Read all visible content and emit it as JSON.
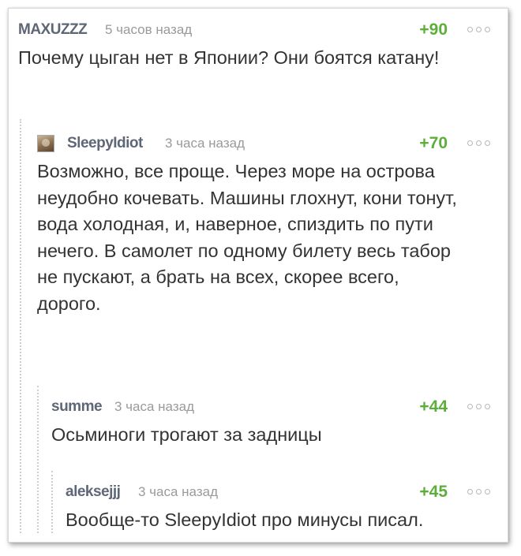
{
  "comments": [
    {
      "author": "MAXUZZZ",
      "time": "5 часов назад",
      "rating": "+90",
      "text": "Почему цыган нет в Японии? Они боятся катану!"
    },
    {
      "author": "SleepyIdiot",
      "time": "3 часа назад",
      "rating": "+70",
      "text": "Возможно, все проще. Через море на острова неудобно кочевать. Машины глохнут, кони тонут, вода холодная, и, наверное, спиздить по пути нечего. В самолет по одному билету весь табор не пускают, а брать на всех, скорее всего, дорого."
    },
    {
      "author": "summe",
      "time": "3 часа назад",
      "rating": "+44",
      "text": "Осьминоги трогают за задницы"
    },
    {
      "author": "aleksejjj",
      "time": "3 часа назад",
      "rating": "+45",
      "text": "Вообще-то SleepyIdiot про минусы писал."
    }
  ]
}
